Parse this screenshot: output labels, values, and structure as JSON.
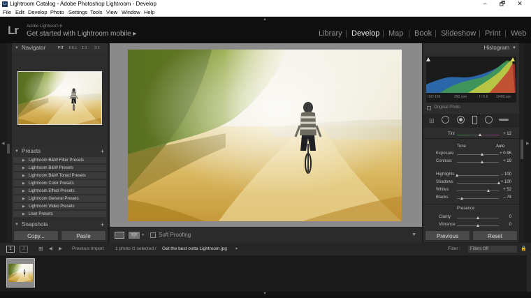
{
  "window": {
    "title": "Lightroom Catalog - Adobe Photoshop Lightroom - Develop",
    "icon": "Lr",
    "min": "‒",
    "restore": "🗗",
    "close": "✕"
  },
  "menu": [
    "File",
    "Edit",
    "Develop",
    "Photo",
    "Settings",
    "Tools",
    "View",
    "Window",
    "Help"
  ],
  "identity": {
    "logo": "Lr",
    "version": "Adobe Lightroom 6",
    "mobile": "Get started with Lightroom mobile ▸"
  },
  "modules": [
    "Library",
    "Develop",
    "Map",
    "Book",
    "Slideshow",
    "Print",
    "Web"
  ],
  "active_module": "Develop",
  "navigator": {
    "title": "Navigator",
    "zoom": [
      "FIT",
      "FILL",
      "1:1",
      "3:1"
    ]
  },
  "presets": {
    "title": "Presets",
    "add": "+",
    "items": [
      "Lightroom B&W Filter Presets",
      "Lightroom B&W Presets",
      "Lightroom B&W Toned Presets",
      "Lightroom Color Presets",
      "Lightroom Effect Presets",
      "Lightroom General Presets",
      "Lightroom Video Presets",
      "User Presets"
    ]
  },
  "snapshots": {
    "title": "Snapshots",
    "add": "+"
  },
  "left_buttons": {
    "copy": "Copy...",
    "paste": "Paste"
  },
  "toolbar": {
    "soft_proofing": "Soft Proofing",
    "yy": "Y|Y"
  },
  "histogram": {
    "title": "Histogram",
    "iso": "ISO 100",
    "focal": "250 mm",
    "aperture": "f / 5.6",
    "shutter": "1/400 sec",
    "original": "Original Photo"
  },
  "tint": {
    "label": "Tint",
    "value": "+ 12",
    "level": 0.56
  },
  "tone": {
    "title": "Tone",
    "auto": "Auto",
    "sliders": [
      {
        "label": "Exposure",
        "value": "+ 0.95",
        "level": 0.6
      },
      {
        "label": "Contrast",
        "value": "+ 19",
        "level": 0.6
      },
      {
        "label": "Highlights",
        "value": "– 100",
        "level": 0.0
      },
      {
        "label": "Shadows",
        "value": "+ 100",
        "level": 1.0
      },
      {
        "label": "Whites",
        "value": "+ 52",
        "level": 0.76
      },
      {
        "label": "Blacks",
        "value": "– 74",
        "level": 0.13
      }
    ]
  },
  "presence": {
    "title": "Presence",
    "sliders": [
      {
        "label": "Clarity",
        "value": "0",
        "level": 0.5
      },
      {
        "label": "Vibrance",
        "value": "0",
        "level": 0.5
      }
    ]
  },
  "right_buttons": {
    "previous": "Previous",
    "reset": "Reset"
  },
  "filmstrip": {
    "view1": "1",
    "view2": "2",
    "source": "Previous Import",
    "info": "1 photo /1 selected /",
    "filename": "Get the best outta  Lightroom.jpg",
    "filter_label": "Filter :",
    "filter_value": "Filters Off"
  },
  "colors": {
    "accent": "#e6e6e6",
    "panel": "#2d2d2d",
    "preset_bg": "#3a3a3a",
    "button": "#4a4a4a"
  }
}
